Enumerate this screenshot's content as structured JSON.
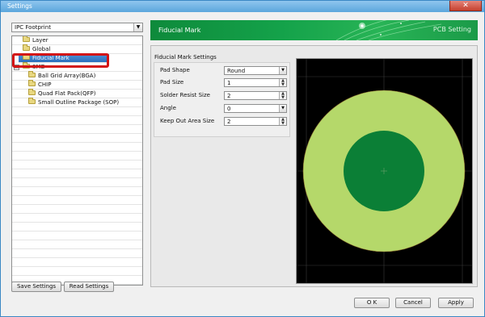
{
  "window": {
    "title": "Settings",
    "close_glyph": "✕"
  },
  "left_panel": {
    "footprint_select": {
      "value": "IPC Footprint",
      "arrow": "▼"
    },
    "tree": [
      {
        "label": "Layer",
        "level": 1,
        "icon": "folder-icon"
      },
      {
        "label": "Global",
        "level": 1,
        "icon": "folder-icon"
      },
      {
        "label": "Fiducial Mark",
        "level": 1,
        "icon": "folder-icon",
        "selected": true
      },
      {
        "label": "SMD",
        "level": 0,
        "icon": "folder-icon",
        "expander": "⊟"
      },
      {
        "label": "Ball Grid Array(BGA)",
        "level": 2,
        "icon": "folder-icon"
      },
      {
        "label": "CHIP",
        "level": 2,
        "icon": "folder-icon"
      },
      {
        "label": "Quad Flat Pack(QFP)",
        "level": 2,
        "icon": "folder-icon"
      },
      {
        "label": "Small Outline Package (SOP)",
        "level": 2,
        "icon": "folder-icon"
      }
    ],
    "save_button": "Save Settings",
    "read_button": "Read Settings"
  },
  "banner": {
    "title": "Fiducial Mark",
    "tag": "PCB Setting",
    "color": "#14a24a"
  },
  "settings": {
    "group_title": "Fiducial Mark Settings",
    "fields": [
      {
        "label": "Pad Shape",
        "value": "Round",
        "type": "dropdown"
      },
      {
        "label": "Pad Size",
        "value": "1",
        "type": "spinner"
      },
      {
        "label": "Solder Resist Size",
        "value": "2",
        "type": "spinner"
      },
      {
        "label": "Angle",
        "value": "0",
        "type": "dropdown"
      },
      {
        "label": "Keep Out Area Size",
        "value": "2",
        "type": "spinner"
      }
    ]
  },
  "preview": {
    "background": "#000000",
    "outer_color": "#b5d86a",
    "inner_color": "#0b7f36"
  },
  "footer": {
    "ok": "O K",
    "cancel": "Cancel",
    "apply": "Apply"
  }
}
